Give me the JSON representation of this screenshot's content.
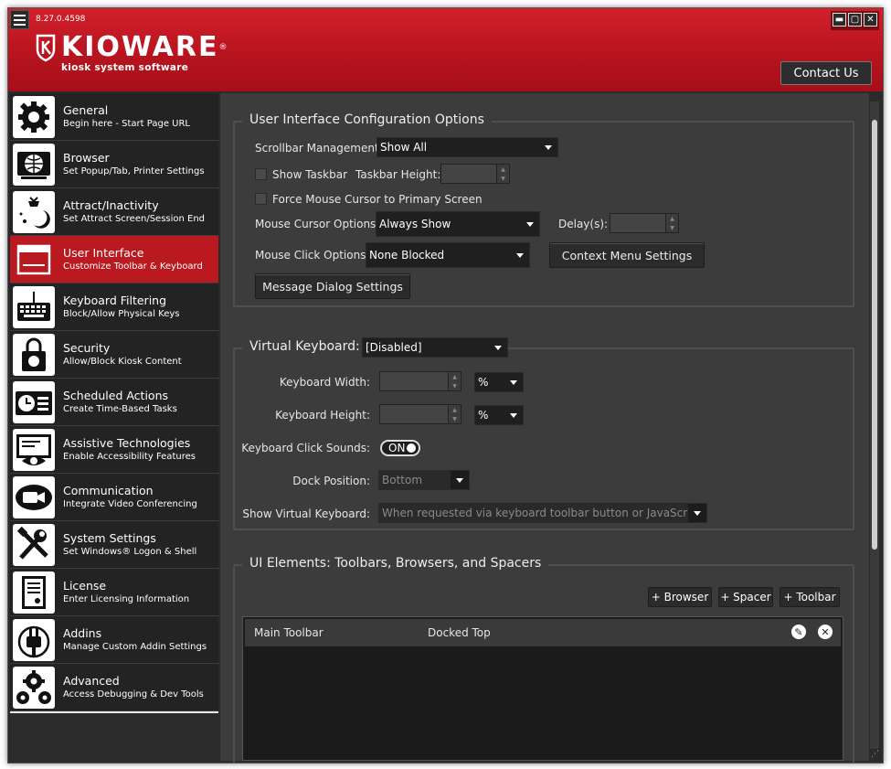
{
  "window": {
    "version": "8.27.0.4598",
    "brand": "KIOWARE",
    "registered": "®",
    "tagline": "kiosk system software",
    "contact_label": "Contact Us",
    "controls": {
      "minimize": "▬",
      "maximize": "▢",
      "close": "✕"
    }
  },
  "sidebar": {
    "items": [
      {
        "title": "General",
        "subtitle": "Begin here - Start Page URL",
        "icon": "gear-icon"
      },
      {
        "title": "Browser",
        "subtitle": "Set Popup/Tab, Printer Settings",
        "icon": "browser-icon"
      },
      {
        "title": "Attract/Inactivity",
        "subtitle": "Set Attract Screen/Session End",
        "icon": "moon-icon"
      },
      {
        "title": "User Interface",
        "subtitle": "Customize Toolbar & Keyboard",
        "icon": "window-icon"
      },
      {
        "title": "Keyboard Filtering",
        "subtitle": "Block/Allow Physical Keys",
        "icon": "keyboard-icon"
      },
      {
        "title": "Security",
        "subtitle": "Allow/Block Kiosk Content",
        "icon": "lock-icon"
      },
      {
        "title": "Scheduled Actions",
        "subtitle": "Create Time-Based Tasks",
        "icon": "clock-list-icon"
      },
      {
        "title": "Assistive Technologies",
        "subtitle": "Enable Accessibility Features",
        "icon": "eye-icon"
      },
      {
        "title": "Communication",
        "subtitle": "Integrate Video Conferencing",
        "icon": "video-icon"
      },
      {
        "title": "System Settings",
        "subtitle": "Set Windows® Logon & Shell",
        "icon": "tools-icon"
      },
      {
        "title": "License",
        "subtitle": "Enter Licensing Information",
        "icon": "license-icon"
      },
      {
        "title": "Addins",
        "subtitle": "Manage Custom Addin Settings",
        "icon": "plug-icon"
      },
      {
        "title": "Advanced",
        "subtitle": "Access Debugging & Dev Tools",
        "icon": "gears-icon"
      }
    ],
    "active_index": 3
  },
  "ui_config": {
    "title": "User Interface Configuration Options",
    "scrollbar_label": "Scrollbar Management:",
    "scrollbar_value": "Show All",
    "show_taskbar_label": "Show Taskbar",
    "show_taskbar_checked": false,
    "taskbar_height_label": "Taskbar Height:",
    "force_cursor_label": "Force Mouse Cursor to Primary Screen",
    "force_cursor_checked": false,
    "cursor_options_label": "Mouse Cursor Options:",
    "cursor_options_value": "Always Show",
    "delay_label": "Delay(s):",
    "click_options_label": "Mouse Click Options:",
    "click_options_value": "None Blocked",
    "context_menu_button": "Context Menu Settings",
    "message_dialog_button": "Message Dialog Settings"
  },
  "virtual_keyboard": {
    "title": "Virtual Keyboard:",
    "mode_value": "[Disabled]",
    "width_label": "Keyboard Width:",
    "width_unit": "%",
    "height_label": "Keyboard Height:",
    "height_unit": "%",
    "click_sounds_label": "Keyboard Click Sounds:",
    "click_sounds_value": "ON",
    "dock_label": "Dock Position:",
    "dock_value": "Bottom",
    "show_label": "Show Virtual Keyboard:",
    "show_value": "When requested via keyboard toolbar button or JavaScript"
  },
  "ui_elements": {
    "title": "UI Elements: Toolbars, Browsers, and Spacers",
    "add_browser": "+ Browser",
    "add_spacer": "+ Spacer",
    "add_toolbar": "+ Toolbar",
    "rows": [
      {
        "name": "Main Toolbar",
        "position": "Docked Top"
      }
    ]
  },
  "colors": {
    "brand_red": "#b9191f",
    "panel": "#3c3c3c",
    "sidebar": "#232323"
  }
}
